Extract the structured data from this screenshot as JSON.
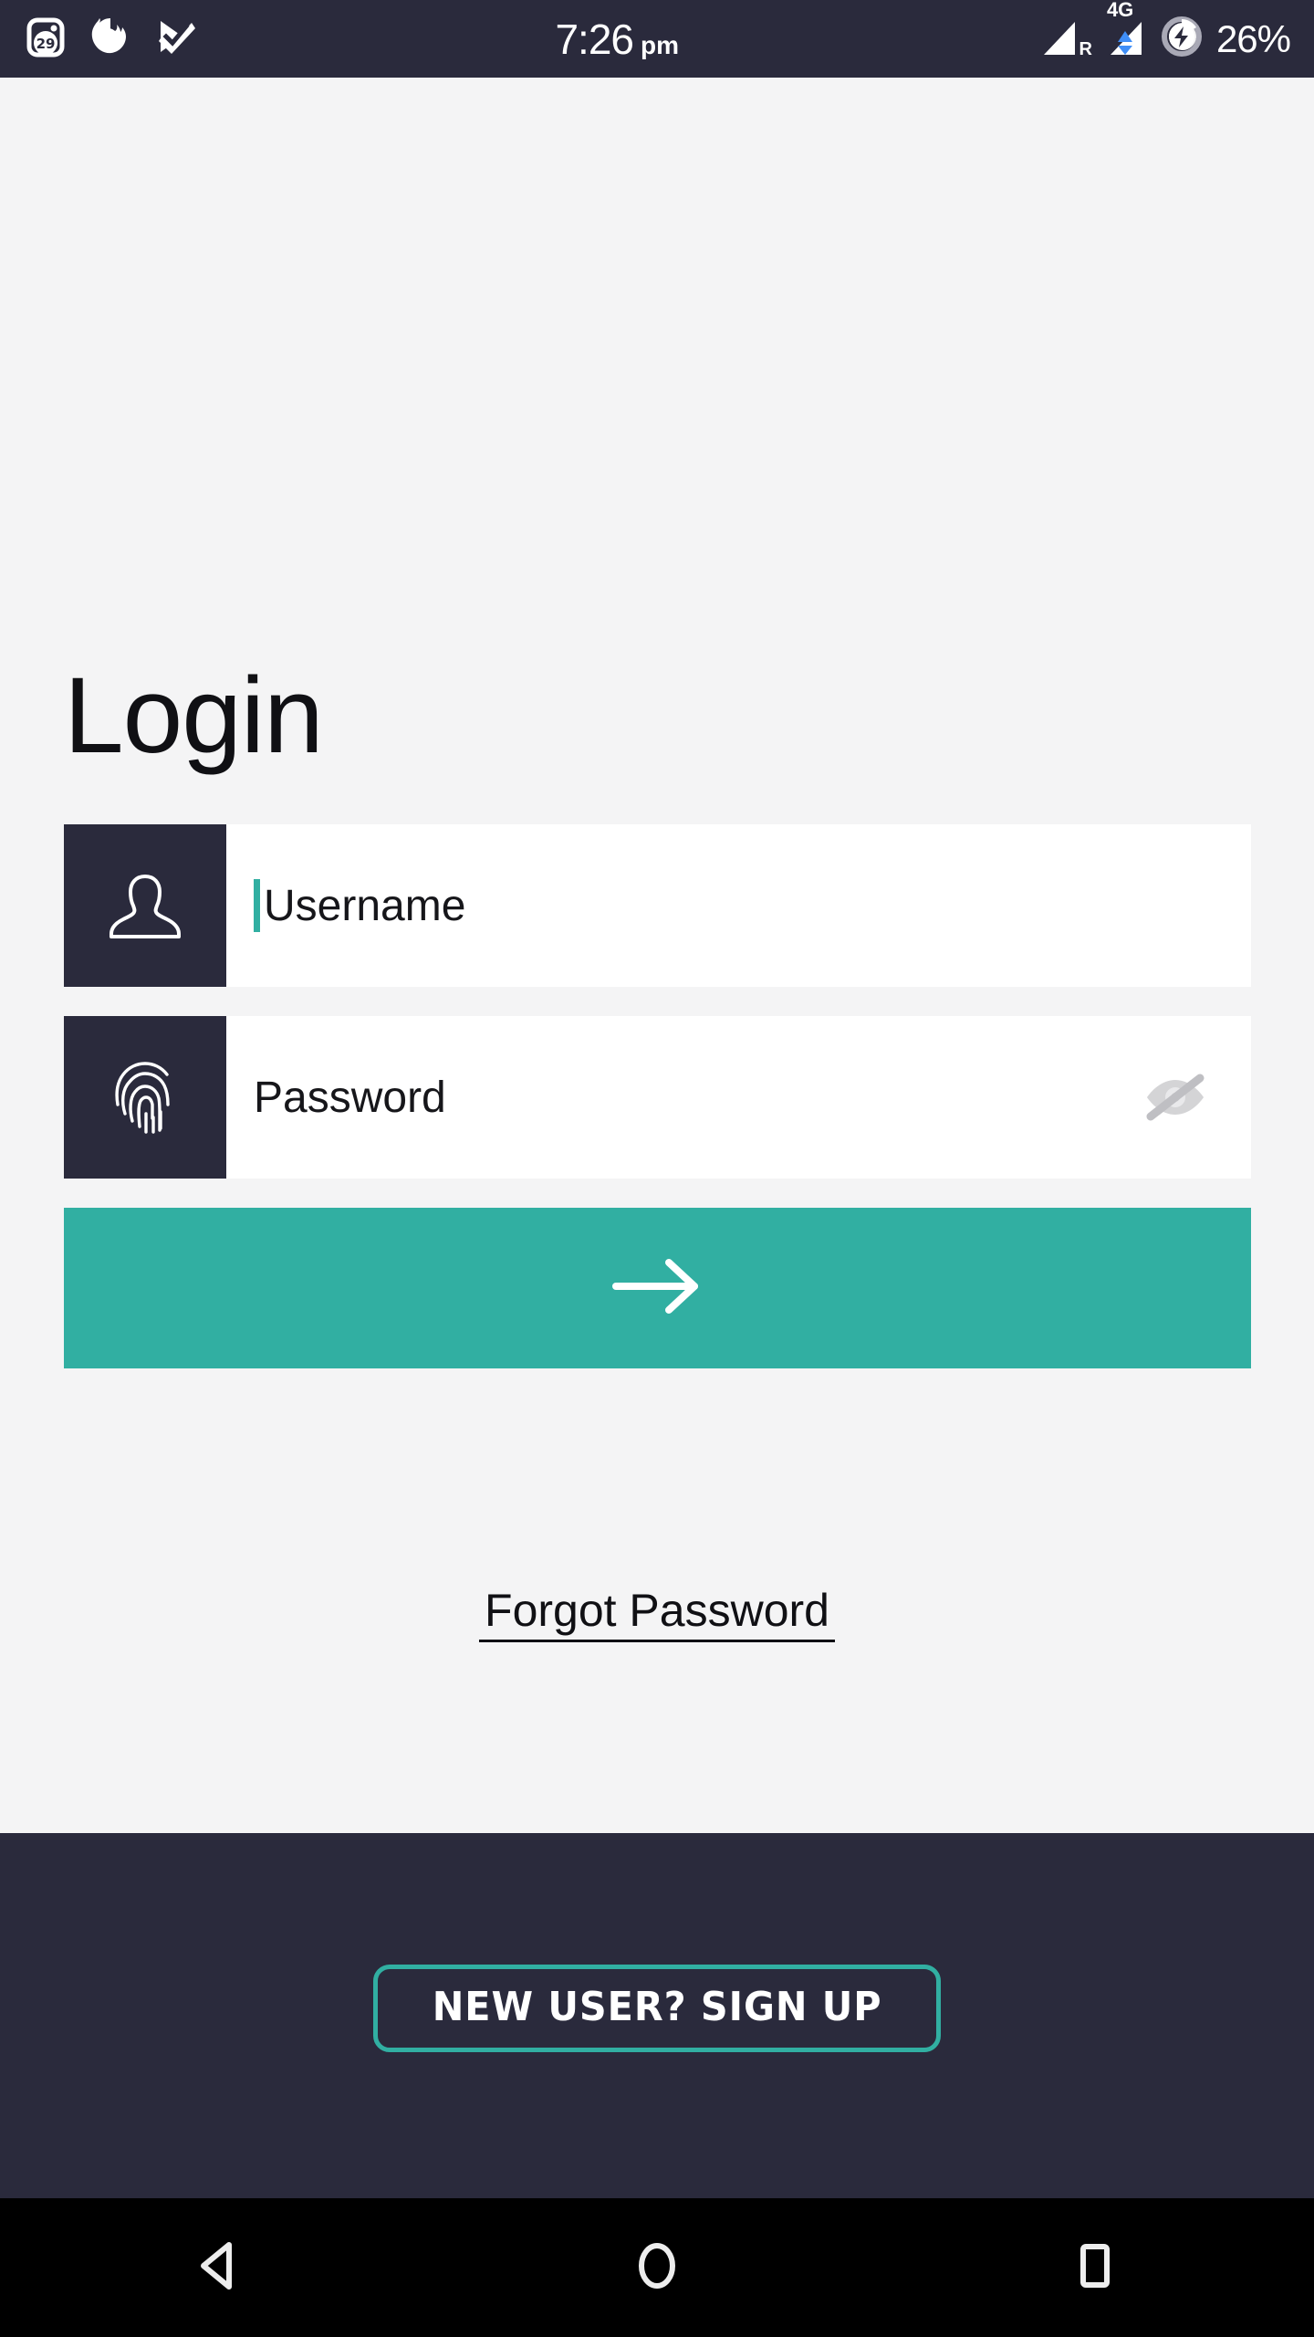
{
  "statusbar": {
    "time": "7:26",
    "ampm": "pm",
    "battery_text": "26%",
    "network_type": "4G",
    "roaming_indicator": "R",
    "left_icons": [
      {
        "name": "calendar-icon",
        "badge": "29"
      },
      {
        "name": "firefox-icon"
      },
      {
        "name": "tasks-checkmark-icon"
      }
    ],
    "right_icons": [
      {
        "name": "signal-bars-icon"
      },
      {
        "name": "signal-bars-data-icon"
      },
      {
        "name": "battery-charging-icon"
      }
    ],
    "colors": {
      "background": "#2A2A3C",
      "foreground": "#FFFFFF"
    }
  },
  "screen": {
    "title": "Login",
    "background": "#F4F4F5"
  },
  "form": {
    "username": {
      "icon": "user-avatar-icon",
      "placeholder": "Username",
      "value": "",
      "caret_color": "#31AFA2"
    },
    "password": {
      "icon": "fingerprint-icon",
      "placeholder": "Password",
      "value": "",
      "visibility_toggle": "eye-off-icon"
    },
    "submit": {
      "icon": "arrow-right-icon",
      "label": "",
      "background": "#31AFA2"
    },
    "forgot_password_label": "Forgot Password"
  },
  "footer": {
    "signup_label": "NEW USER? SIGN UP",
    "background": "#2A2A3C",
    "accent": "#31AFA2"
  },
  "navbar": {
    "background": "#000000",
    "buttons": [
      {
        "name": "back-button",
        "icon": "triangle-left-icon"
      },
      {
        "name": "home-button",
        "icon": "circle-icon"
      },
      {
        "name": "recents-button",
        "icon": "square-icon"
      }
    ]
  }
}
